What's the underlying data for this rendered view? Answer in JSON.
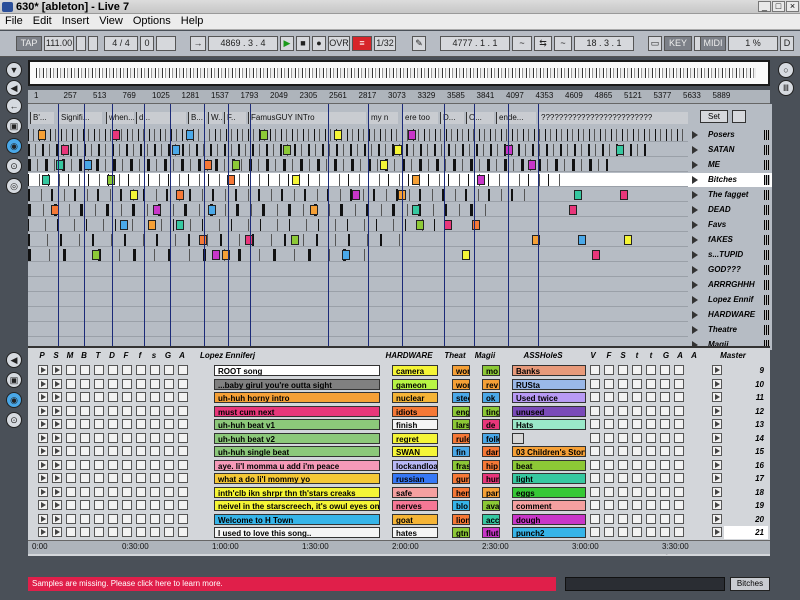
{
  "window": {
    "title": "630* [ableton] - Live 7",
    "buttons": [
      "_",
      "□",
      "×"
    ]
  },
  "menu": [
    "File",
    "Edit",
    "Insert",
    "View",
    "Options",
    "Help"
  ],
  "transport": {
    "tap": "TAP",
    "tempo": "111.00",
    "sig": "4 / 4",
    "metro": "0",
    "pos": "4869 . 3 . 4",
    "quant": "1/32",
    "ovr": "OVR",
    "loop_start": "4777 . 1 . 1",
    "loop_len": "18 . 3 . 1",
    "key": "KEY",
    "midi": "MIDI",
    "cpu": "1 %",
    "d": "D"
  },
  "ruler": {
    "ticks": [
      "1",
      "257",
      "513",
      "769",
      "1025",
      "1281",
      "1537",
      "1793",
      "2049",
      "2305",
      "2561",
      "2817",
      "3073",
      "3329",
      "3585",
      "3841",
      "4097",
      "4353",
      "4609",
      "4865",
      "5121",
      "5377",
      "5633",
      "5889"
    ]
  },
  "locators": [
    "B'...",
    "Signifi...",
    "when...",
    "d...",
    "B...",
    "W...",
    "F..",
    "FamusGUY INTro",
    "my n",
    "ere too",
    "D...",
    "O...",
    "ende...",
    "?????????????????????????"
  ],
  "set_label": "Set",
  "tracks": [
    "Posers",
    "SATAN",
    "ME",
    "Bitches",
    "The fagget",
    "DEAD",
    "Favs",
    "fAKES",
    "s...TUPID",
    "GOD???",
    "ARRRGHHH",
    "Lopez Ennif",
    "HARDWARE",
    "Theatre",
    "Magii"
  ],
  "session": {
    "headers": [
      "P",
      "S",
      "M",
      "B",
      "T",
      "D",
      "F",
      "f",
      "s",
      "G",
      "A",
      "Lopez Enniferj",
      "HARDWARE",
      "Theat",
      "Magii",
      "ASSHoleS",
      "V",
      "F",
      "S",
      "t",
      "t",
      "G",
      "A",
      "A",
      "Master"
    ],
    "rows": [
      {
        "main": "ROOT song",
        "hw": "camera",
        "th": "wor",
        "mg": "mo",
        "ass": "Banks",
        "scene": "9"
      },
      {
        "main": "...baby girul you're  outta sight",
        "hw": "gameon",
        "th": "wor",
        "mg": "rev",
        "ass": "RUSta",
        "scene": "10"
      },
      {
        "main": "uh-huh horny intro",
        "hw": "nuclear",
        "th": "stee",
        "mg": "ok",
        "ass": "Used twice",
        "scene": "11"
      },
      {
        "main": "must cum next",
        "hw": "idiots",
        "th": "eng",
        "mg": "ting",
        "ass": "unused",
        "scene": "12"
      },
      {
        "main": "uh-huh beat v1",
        "hw": "finish",
        "th": "lars",
        "mg": "de",
        "ass": "Hats",
        "scene": "13"
      },
      {
        "main": "uh-huh beat v2",
        "hw": "regret",
        "th": "rule",
        "mg": "folk",
        "ass": "",
        "scene": "14"
      },
      {
        "main": "uh-huh single beat",
        "hw": "SWAN",
        "th": "fin",
        "mg": "dar",
        "ass": "03 Children's Story",
        "scene": "15"
      },
      {
        "main": "aye. li'l momma u add i'm peace",
        "hw": "lockandload",
        "th": "fras",
        "mg": "hip",
        "ass": "beat",
        "scene": "16"
      },
      {
        "main": "what a do li'l mommy yo",
        "hw": "russian",
        "th": "gun",
        "mg": "hum",
        "ass": "light",
        "scene": "17"
      },
      {
        "main": "inth'clb ikn shrpr thn th'stars creaks",
        "hw": "safe",
        "th": "hen",
        "mg": "part",
        "ass": "eggs",
        "scene": "18"
      },
      {
        "main": "neivel in the starscreech, it's owul eyes on u",
        "hw": "nerves",
        "th": "blo",
        "mg": "ava",
        "ass": "comment",
        "scene": "19"
      },
      {
        "main": "Welcome to H Town",
        "hw": "goat",
        "th": "lion",
        "mg": "acc",
        "ass": "dough",
        "scene": "20"
      },
      {
        "main": "I used  to love this song..",
        "hw": "hates",
        "th": "gtn",
        "mg": "fluti",
        "ass": "punch2",
        "scene": "21"
      }
    ],
    "master": "Master",
    "position": "128/1"
  },
  "timeline": [
    "0:00",
    "0:30:00",
    "1:00:00",
    "1:30:00",
    "2:00:00",
    "2:30:00",
    "3:00:00",
    "3:30:00"
  ],
  "status": {
    "message": "Samples are missing. Please click here to learn more.",
    "clip": "Bitches"
  },
  "colors": {
    "hw": [
      "#f5f536",
      "#b8f544",
      "#f5b436",
      "#f57836",
      "#f5f5f5",
      "#f5f536",
      "#f5f536",
      "#b8b8f5",
      "#3678f5",
      "#f5a0a0",
      "#f57896",
      "#f5b436",
      "#f5f5f5"
    ],
    "main": [
      "#ffffff",
      "#808080",
      "#f5a036",
      "#e8367a",
      "#8cc87a",
      "#8cc87a",
      "#8cc87a",
      "#f59ab8",
      "#f5c836",
      "#f5f536",
      "#f5f536",
      "#36b4e8",
      "#f5f5f5"
    ],
    "ass": [
      "#e89a7a",
      "#9ab8e8",
      "#b89af5",
      "#7a4ab8",
      "#9ae8c8",
      "#d6d6d6",
      "#f5a036",
      "#8cc836",
      "#36c8a0",
      "#36c836",
      "#f5a0a0",
      "#c836c8",
      "#36b4e8"
    ]
  }
}
